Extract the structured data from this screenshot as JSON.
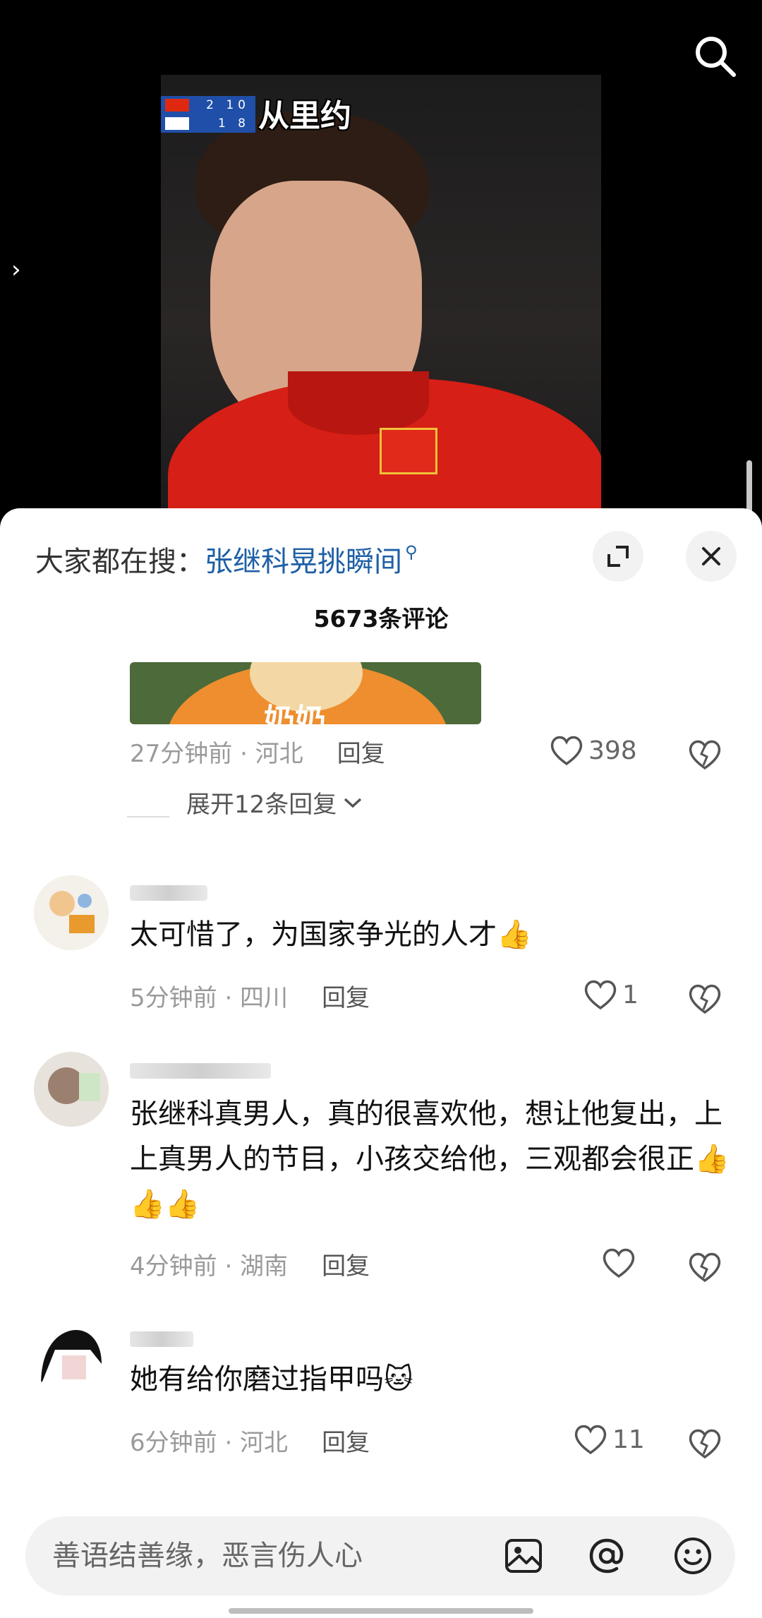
{
  "video": {
    "caption": "从里约",
    "score": {
      "rows": [
        {
          "country": "CHN",
          "sets": "2",
          "points": "10"
        },
        {
          "country": "KOR",
          "sets": "1",
          "points": "8"
        }
      ]
    }
  },
  "sheet": {
    "hot_search_label": "大家都在搜：",
    "hot_search_term": "张继科晃挑瞬间",
    "comment_count": "5673条评论",
    "image_text": "奶奶",
    "first_meta": {
      "time": "27分钟前 · 河北",
      "reply": "回复",
      "likes": "398"
    },
    "expand_replies": "展开12条回复",
    "comments": [
      {
        "text": "太可惜了，为国家争光的人才",
        "emojis": [
          "👍"
        ],
        "meta": {
          "time": "5分钟前 · 四川",
          "reply": "回复",
          "likes": "1"
        }
      },
      {
        "text": "张继科真男人，真的很喜欢他，想让他复出，上上真男人的节目，小孩交给他，三观都会很正",
        "emojis": [
          "👍",
          "👍",
          "👍"
        ],
        "meta": {
          "time": "4分钟前 · 湖南",
          "reply": "回复",
          "likes": ""
        }
      },
      {
        "text": "她有给你磨过指甲吗",
        "emojis": [
          "🐱"
        ],
        "meta": {
          "time": "6分钟前 · 河北",
          "reply": "回复",
          "likes": "11"
        }
      }
    ]
  },
  "input": {
    "placeholder": "善语结善缘，恶言伤人心"
  },
  "colors": {
    "link_blue": "#1e5fa6",
    "shirt_red": "#d61f16"
  }
}
